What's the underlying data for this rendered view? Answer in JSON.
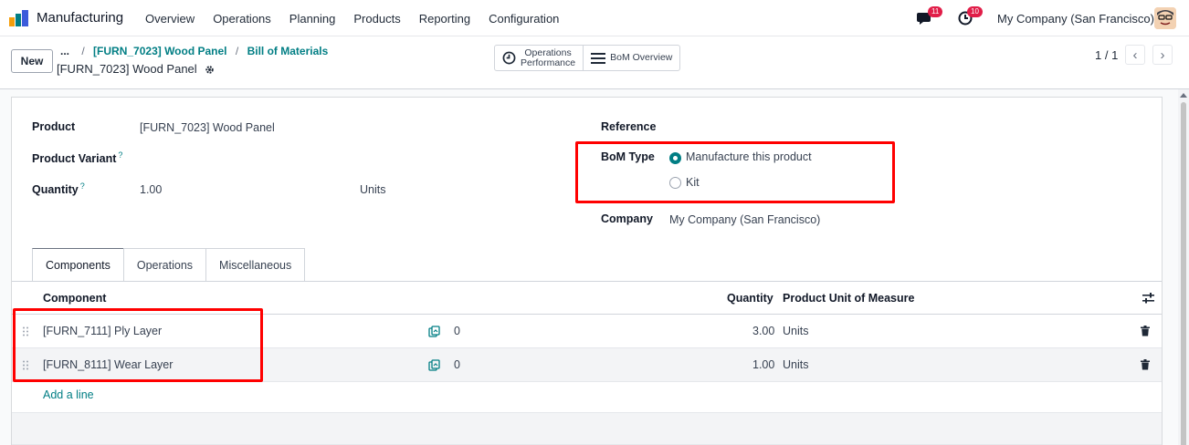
{
  "navbar": {
    "app_name": "Manufacturing",
    "menu": [
      "Overview",
      "Operations",
      "Planning",
      "Products",
      "Reporting",
      "Configuration"
    ],
    "messages_count": "11",
    "activities_count": "10",
    "company": "My Company (San Francisco)"
  },
  "control": {
    "new_label": "New",
    "breadcrumb_ellipsis": "...",
    "breadcrumb": [
      "[FURN_7023] Wood Panel",
      "Bill of Materials"
    ],
    "record_title": "[FURN_7023] Wood Panel",
    "smart_buttons": {
      "operations_line1": "Operations",
      "operations_line2": "Performance",
      "bom_overview": "BoM Overview"
    },
    "pager": "1 / 1"
  },
  "form": {
    "product_label": "Product",
    "product_value": "[FURN_7023] Wood Panel",
    "variant_label": "Product Variant",
    "quantity_label": "Quantity",
    "help_mark": "?",
    "quantity_value": "1.00",
    "quantity_uom": "Units",
    "reference_label": "Reference",
    "bom_type_label": "BoM Type",
    "bom_type_options": [
      "Manufacture this product",
      "Kit"
    ],
    "bom_type_selected": "Manufacture this product",
    "company_label": "Company",
    "company_value": "My Company (San Francisco)"
  },
  "tabs": [
    "Components",
    "Operations",
    "Miscellaneous"
  ],
  "active_tab": "Components",
  "table": {
    "headers": {
      "component": "Component",
      "quantity": "Quantity",
      "uom": "Product Unit of Measure"
    },
    "rows": [
      {
        "component": "[FURN_7111] Ply Layer",
        "availability": "0",
        "quantity": "3.00",
        "uom": "Units"
      },
      {
        "component": "[FURN_8111] Wear Layer",
        "availability": "0",
        "quantity": "1.00",
        "uom": "Units"
      }
    ],
    "add_line": "Add a line"
  },
  "colors": {
    "accent": "#017e84",
    "badge": "#e11d48",
    "highlight": "#ff0000"
  }
}
